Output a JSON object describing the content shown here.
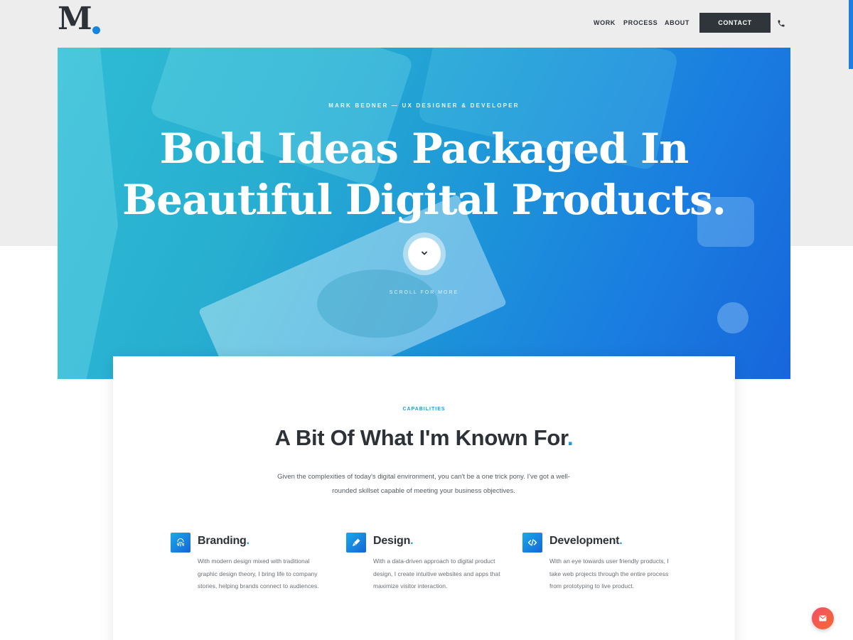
{
  "header": {
    "logo_letter": "M",
    "nav": {
      "work": "WORK",
      "process": "PROCESS",
      "about": "ABOUT",
      "contact": "CONTACT"
    }
  },
  "hero": {
    "eyebrow": "MARK BEDNER — UX DESIGNER & DEVELOPER",
    "title_line1": "Bold Ideas Packaged In",
    "title_line2": "Beautiful Digital Products.",
    "scroll_label": "SCROLL FOR MORE"
  },
  "capabilities": {
    "eyebrow": "CAPABILITIES",
    "title": "A Bit Of What I'm Known For",
    "title_dot": ".",
    "description": "Given the complexities of today's digital environment, you can't be a one trick pony. I've got a well-rounded skillset capable of meeting your business objectives.",
    "features": [
      {
        "title": "Branding",
        "dot": ".",
        "icon": "fingerprint-icon",
        "text": "With modern design mixed with traditional graphic design theory, I bring life to company stories, helping brands connect to audiences."
      },
      {
        "title": "Design",
        "dot": ".",
        "icon": "pen-icon",
        "text": "With a data-driven approach to digital product design, I create intuitive websites and apps that maximize visitor interaction."
      },
      {
        "title": "Development",
        "dot": ".",
        "icon": "code-icon",
        "text": "With an eye towards user friendly products, I take web projects through the entire process from prototyping to live product."
      }
    ]
  },
  "colors": {
    "accent": "#1e9ad6",
    "dark": "#2f353b",
    "hero_gradient_start": "#2fbcd4",
    "hero_gradient_end": "#1766db",
    "chat_gradient_start": "#f44d6a",
    "chat_gradient_end": "#f46a2e"
  },
  "icons": {
    "phone": "phone-icon",
    "scroll": "chevron-down-icon",
    "chat": "envelope-icon"
  }
}
